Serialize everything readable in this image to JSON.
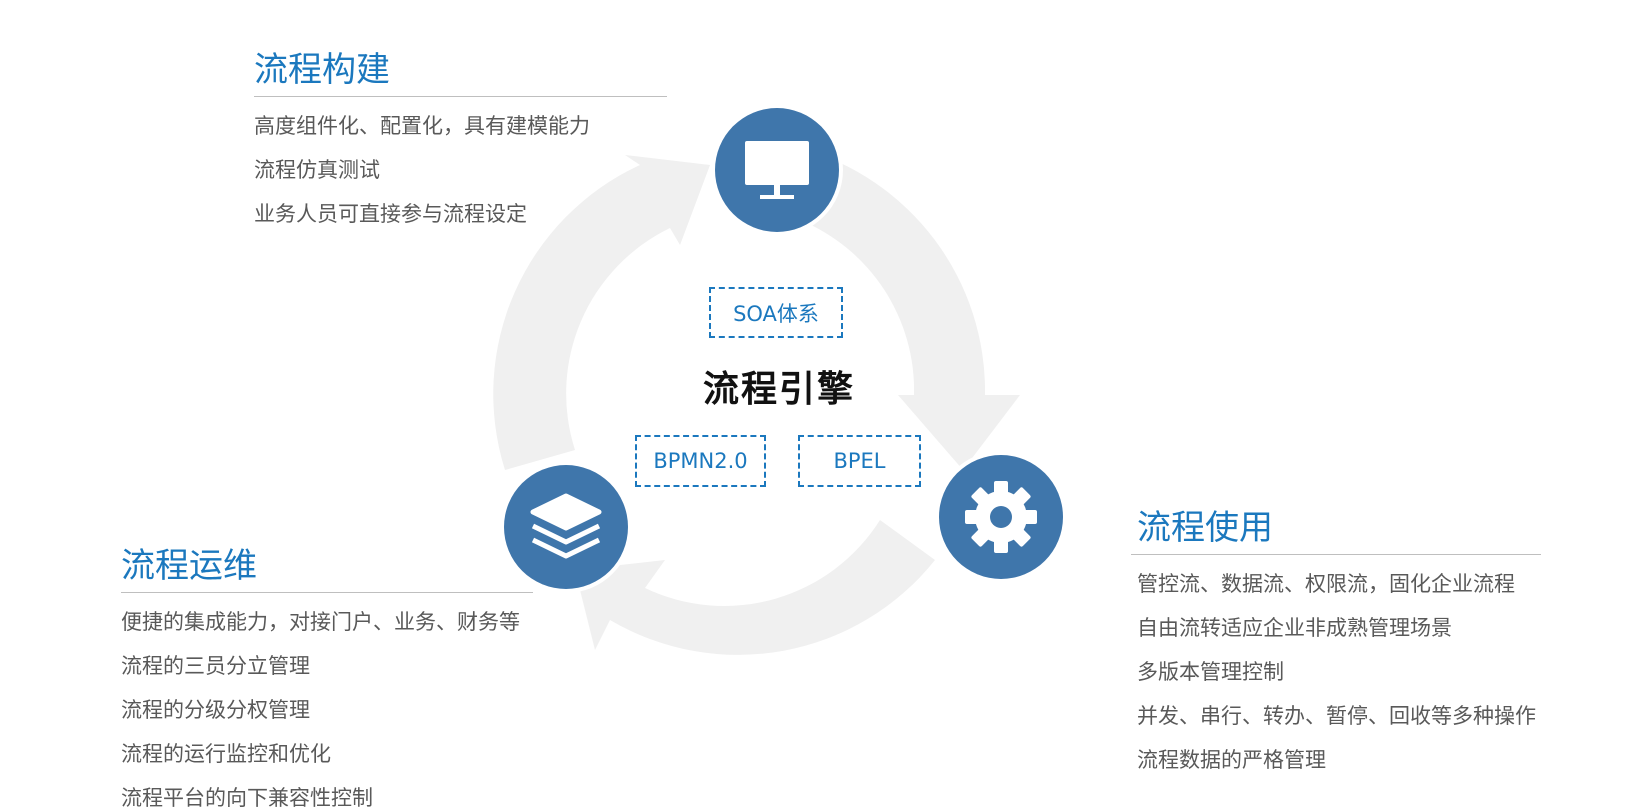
{
  "center": {
    "title": "流程引擎",
    "tags": [
      "SOA体系",
      "BPMN2.0",
      "BPEL"
    ]
  },
  "sections": {
    "build": {
      "title": "流程构建",
      "items": [
        "高度组件化、配置化，具有建模能力",
        "流程仿真测试",
        "业务人员可直接参与流程设定"
      ],
      "icon": "monitor-icon"
    },
    "use": {
      "title": "流程使用",
      "items": [
        "管控流、数据流、权限流，固化企业流程",
        "自由流转适应企业非成熟管理场景",
        "多版本管理控制",
        "并发、串行、转办、暂停、回收等多种操作",
        "流程数据的严格管理"
      ],
      "icon": "gear-icon"
    },
    "ops": {
      "title": "流程运维",
      "items": [
        "便捷的集成能力，对接门户、业务、财务等",
        "流程的三员分立管理",
        "流程的分级分权管理",
        "流程的运行监控和优化",
        "流程平台的向下兼容性控制"
      ],
      "icon": "layers-icon"
    }
  },
  "colors": {
    "accent": "#1b78be",
    "node": "#3f76ab",
    "ring": "#f0f0f0",
    "text": "#595959"
  }
}
